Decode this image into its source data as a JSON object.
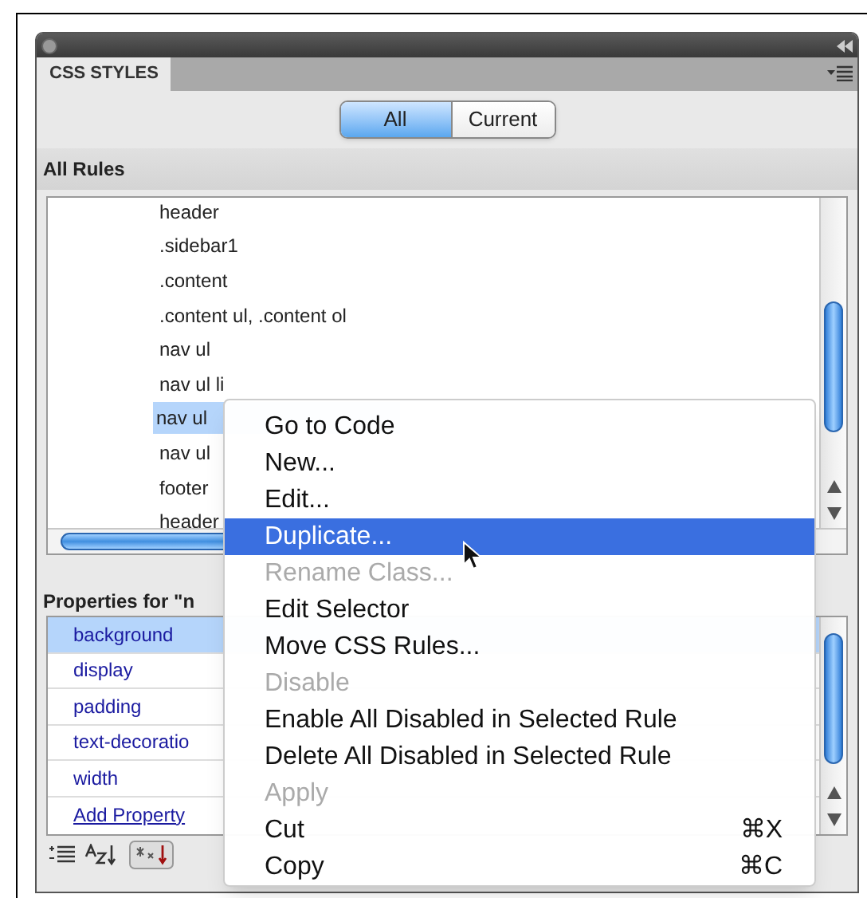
{
  "panel": {
    "tab": "CSS STYLES"
  },
  "toggle": [
    {
      "label": "All",
      "selected": true
    },
    {
      "label": "Current",
      "selected": false
    }
  ],
  "rules_header": "All Rules",
  "rules": [
    {
      "label": "header",
      "selected": false
    },
    {
      "label": ".sidebar1",
      "selected": false
    },
    {
      "label": ".content",
      "selected": false
    },
    {
      "label": ".content ul, .content ol",
      "selected": false
    },
    {
      "label": "nav ul",
      "selected": false
    },
    {
      "label": "nav ul li",
      "selected": false
    },
    {
      "label": "nav ul",
      "selected": true
    },
    {
      "label": "nav ul",
      "selected": false
    },
    {
      "label": "footer",
      "selected": false
    },
    {
      "label": "header",
      "selected": false
    }
  ],
  "properties_header": "Properties for \"n",
  "properties": [
    {
      "label": "background",
      "selected": true
    },
    {
      "label": "display",
      "selected": false
    },
    {
      "label": "padding",
      "selected": false
    },
    {
      "label": "text-decoratio",
      "selected": false
    },
    {
      "label": "width",
      "selected": false
    }
  ],
  "add_property": "Add Property",
  "context_menu": [
    {
      "label": "Go to Code",
      "selected": false,
      "disabled": false
    },
    {
      "label": "New...",
      "selected": false,
      "disabled": false
    },
    {
      "label": "Edit...",
      "selected": false,
      "disabled": false
    },
    {
      "label": "Duplicate...",
      "selected": true,
      "disabled": false
    },
    {
      "label": "Rename Class...",
      "selected": false,
      "disabled": true
    },
    {
      "label": "Edit Selector",
      "selected": false,
      "disabled": false
    },
    {
      "label": "Move CSS Rules...",
      "selected": false,
      "disabled": false
    },
    {
      "label": "Disable",
      "selected": false,
      "disabled": true
    },
    {
      "label": "Enable All Disabled in Selected Rule",
      "selected": false,
      "disabled": false
    },
    {
      "label": "Delete All Disabled in Selected Rule",
      "selected": false,
      "disabled": false
    },
    {
      "label": "Apply",
      "selected": false,
      "disabled": true
    },
    {
      "label": "Cut",
      "shortcut": "⌘X",
      "selected": false,
      "disabled": false
    },
    {
      "label": "Copy",
      "shortcut": "⌘C",
      "selected": false,
      "disabled": false
    }
  ]
}
